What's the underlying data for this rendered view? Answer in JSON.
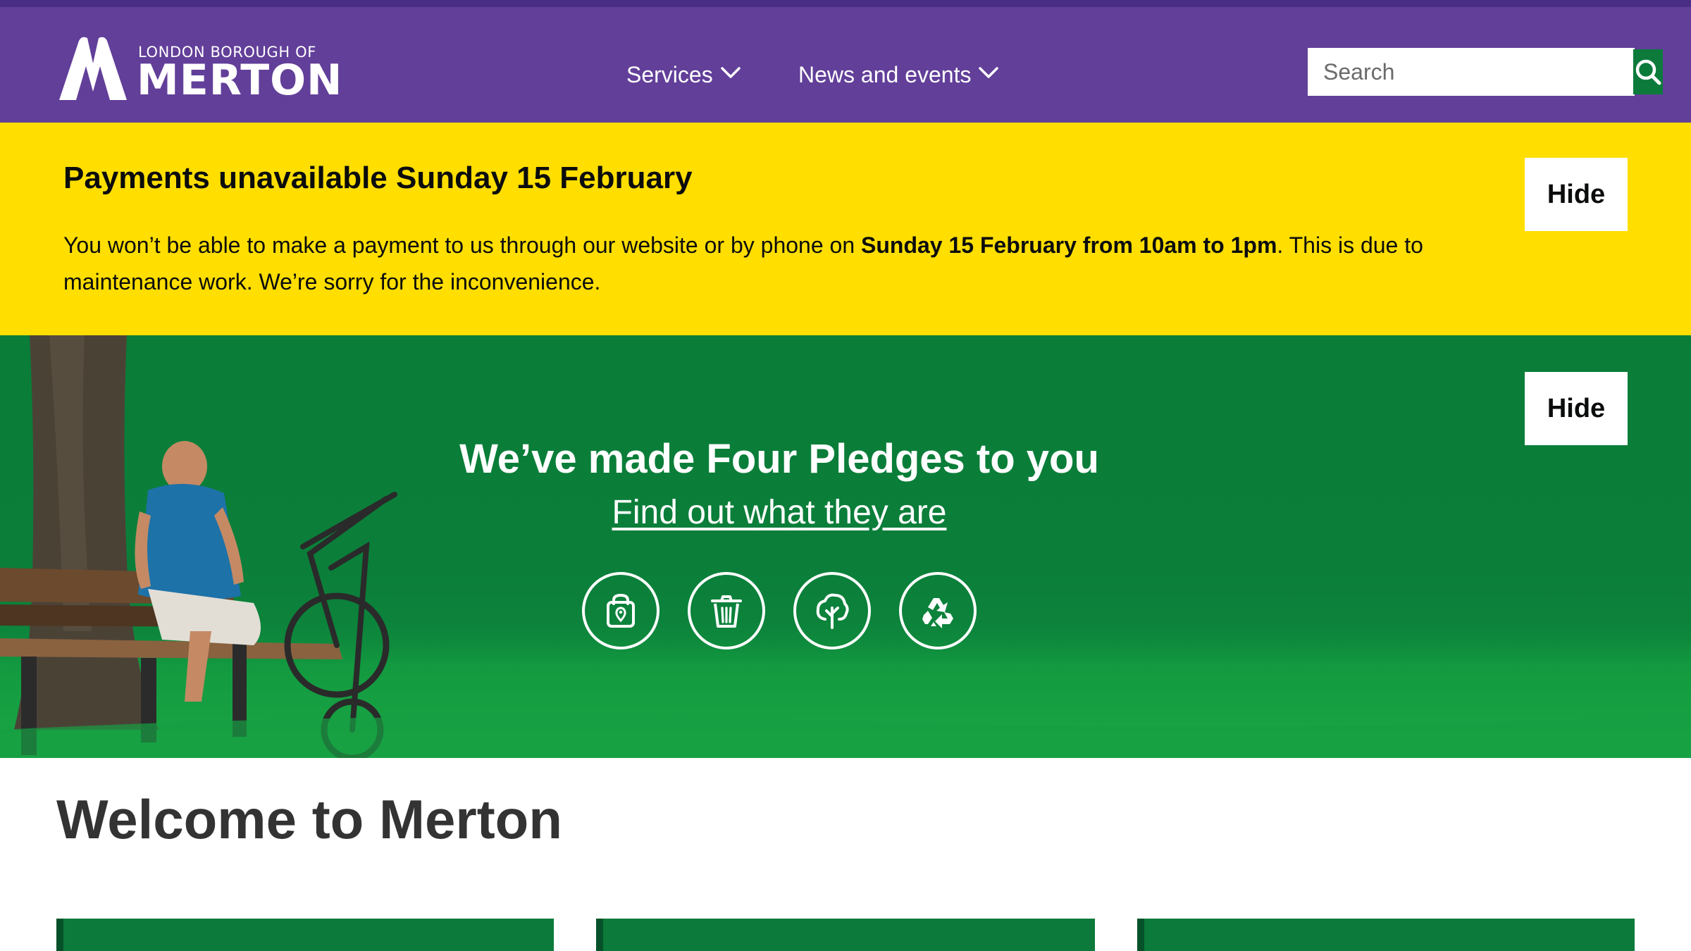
{
  "header": {
    "logo_top": "LONDON BOROUGH OF",
    "logo_main": "MERTON",
    "nav": [
      {
        "label": "Services"
      },
      {
        "label": "News and events"
      }
    ],
    "search": {
      "placeholder": "Search",
      "value": ""
    }
  },
  "alert": {
    "title": "Payments unavailable Sunday 15 February",
    "body_before": "You won’t be able to make a payment to us through our website or by phone on ",
    "body_bold": "Sunday 15 February from 10am to 1pm",
    "body_after": ". This is due to maintenance work. We’re sorry for the inconvenience.",
    "hide_label": "Hide"
  },
  "banner": {
    "title": "We’ve made Four Pledges to you",
    "link": "Find out what they are",
    "hide_label": "Hide",
    "icons": [
      "handbag-icon",
      "bin-icon",
      "tree-icon",
      "recycle-icon"
    ]
  },
  "main": {
    "title": "Welcome to Merton",
    "cards": [
      "",
      "",
      ""
    ]
  },
  "colors": {
    "header_purple": "#623f99",
    "alert_yellow": "#ffde00",
    "banner_green": "#0b7a3b",
    "search_button": "#0b7a3b"
  }
}
